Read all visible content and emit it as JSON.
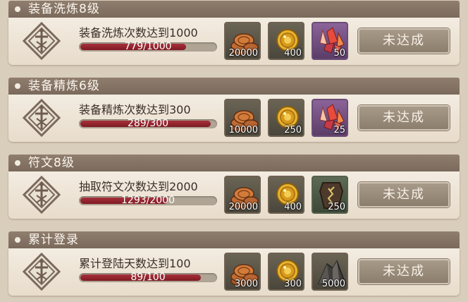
{
  "achievements": [
    {
      "title": "装备洗炼8级",
      "description": "装备洗炼次数达到1000",
      "progress_text": "779/1000",
      "progress": 0.779,
      "rewards": [
        {
          "icon": "copper-coins-icon",
          "qty": "20000",
          "slot": "gray"
        },
        {
          "icon": "gold-coin-icon",
          "qty": "400",
          "slot": "gray"
        },
        {
          "icon": "crystal-icon",
          "qty": "50",
          "slot": "purple"
        }
      ],
      "status_label": "未达成"
    },
    {
      "title": "装备精炼6级",
      "description": "装备精炼次数达到300",
      "progress_text": "289/300",
      "progress": 0.963,
      "rewards": [
        {
          "icon": "copper-coins-icon",
          "qty": "10000",
          "slot": "gray"
        },
        {
          "icon": "gold-coin-icon",
          "qty": "250",
          "slot": "gray"
        },
        {
          "icon": "crystal-icon",
          "qty": "25",
          "slot": "purple"
        }
      ],
      "status_label": "未达成"
    },
    {
      "title": "符文8级",
      "description": "抽取符文次数达到2000",
      "progress_text": "1293/2000",
      "progress": 0.6465,
      "rewards": [
        {
          "icon": "copper-coins-icon",
          "qty": "20000",
          "slot": "gray"
        },
        {
          "icon": "gold-coin-icon",
          "qty": "400",
          "slot": "gray"
        },
        {
          "icon": "rune-stone-icon",
          "qty": "250",
          "slot": "green"
        }
      ],
      "status_label": "未达成"
    },
    {
      "title": "累计登录",
      "description": "累计登陆天数达到100",
      "progress_text": "89/100",
      "progress": 0.89,
      "rewards": [
        {
          "icon": "copper-coins-icon",
          "qty": "3000",
          "slot": "gray"
        },
        {
          "icon": "gold-coin-icon",
          "qty": "300",
          "slot": "gray"
        },
        {
          "icon": "ore-icon",
          "qty": "5000",
          "slot": "gray"
        }
      ],
      "status_label": "未达成"
    }
  ]
}
